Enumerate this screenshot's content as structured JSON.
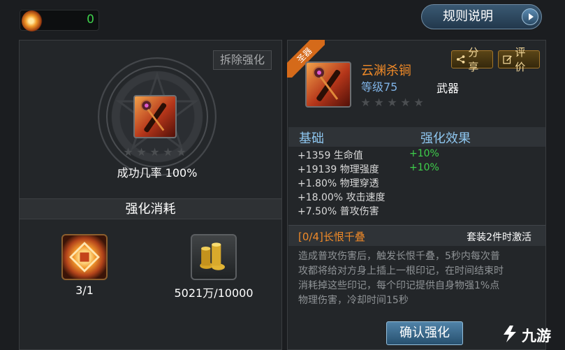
{
  "currency": {
    "amount": "0",
    "icon": "fire-orb-icon"
  },
  "header": {
    "rules_button": "规则说明"
  },
  "left": {
    "dismantle_button": "拆除强化",
    "success_rate": "成功几率 100%",
    "star_count": 5,
    "cost_header": "强化消耗",
    "materials": [
      {
        "icon": "enhance-stone-icon",
        "qty": "3/1"
      },
      {
        "icon": "gold-coins-icon",
        "qty": "5021万/10000"
      }
    ]
  },
  "right": {
    "holy_tag": "圣器",
    "item": {
      "name": "云渊杀锏",
      "level": "等级75",
      "type": "武器",
      "icon": "mace-weapon-icon",
      "star_count": 5
    },
    "share_button": "分享",
    "review_button": "评价",
    "stats_header": {
      "base": "基础",
      "bonus": "强化效果"
    },
    "stats": [
      {
        "text": "+1359 生命值",
        "bonus": "+10%"
      },
      {
        "text": "+19139 物理强度",
        "bonus": "+10%"
      },
      {
        "text": "+1.80% 物理穿透",
        "bonus": ""
      },
      {
        "text": "+18.00% 攻击速度",
        "bonus": ""
      },
      {
        "text": "+7.50% 普攻伤害",
        "bonus": ""
      }
    ],
    "set": {
      "name": "[0/4]长恨千叠",
      "activate": "套装2件时激活",
      "desc_lines": [
        "造成普攻伤害后，触发长恨千叠，5秒内每次普",
        "攻都将给对方身上插上一根印记，在时间结束时",
        "消耗掉这些印记，每个印记提供自身物强1%点",
        "物理伤害，冷却时间15秒"
      ]
    },
    "confirm_button": "确认强化"
  },
  "watermark": {
    "text": "九游"
  },
  "colors": {
    "orange": "#f08a28",
    "green": "#3ed04b",
    "blue": "#8ec6ef",
    "panel": "#232629"
  }
}
